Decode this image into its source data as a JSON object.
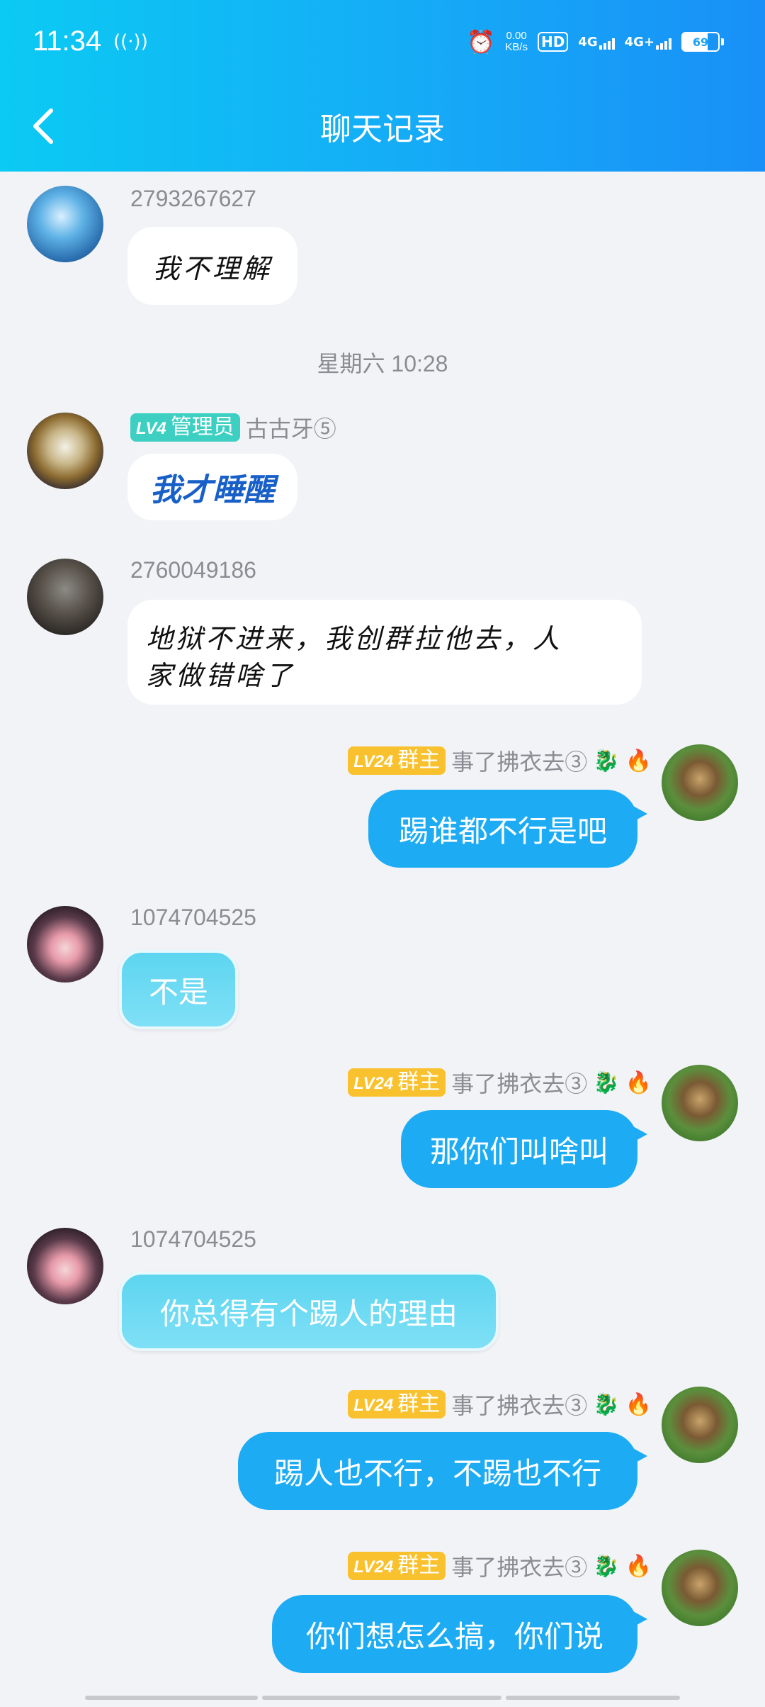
{
  "status_bar": {
    "time": "11:34",
    "speed_value": "0.00",
    "speed_unit": "KB/s",
    "hd_label": "HD",
    "net1": "4G",
    "net2": "4G+",
    "battery": "69",
    "battery_level_percent": 69
  },
  "header": {
    "title": "聊天记录"
  },
  "messages": [
    {
      "sender": "2793267627",
      "text": "我不理解"
    },
    {
      "separator": "星期六 10:28"
    },
    {
      "badge_level": "LV4",
      "badge_role": "管理员",
      "sender": "古古牙⑤",
      "text": "我才睡醒"
    },
    {
      "sender": "2760049186",
      "text_line1": "地狱不进来，我创群拉他去，人",
      "text_line2": "家做错啥了"
    },
    {
      "badge_level": "LV24",
      "badge_role": "群主",
      "sender": "事了拂衣去③",
      "text": "踢谁都不行是吧"
    },
    {
      "sender": "1074704525",
      "text": "不是"
    },
    {
      "badge_level": "LV24",
      "badge_role": "群主",
      "sender": "事了拂衣去③",
      "text": "那你们叫啥叫"
    },
    {
      "sender": "1074704525",
      "text": "你总得有个踢人的理由"
    },
    {
      "badge_level": "LV24",
      "badge_role": "群主",
      "sender": "事了拂衣去③",
      "text": "踢人也不行，不踢也不行"
    },
    {
      "badge_level": "LV24",
      "badge_role": "群主",
      "sender": "事了拂衣去③",
      "text": "你们想怎么搞，你们说"
    }
  ],
  "emoji": {
    "dragon": "🐉",
    "fire": "🔥"
  },
  "colors": {
    "header_start": "#0bcaf3",
    "header_end": "#1890f7",
    "outgoing_bubble": "#1dacf4",
    "admin_badge": "#3dd0c2",
    "owner_badge": "#f8c12d",
    "background": "#f2f3f7"
  }
}
